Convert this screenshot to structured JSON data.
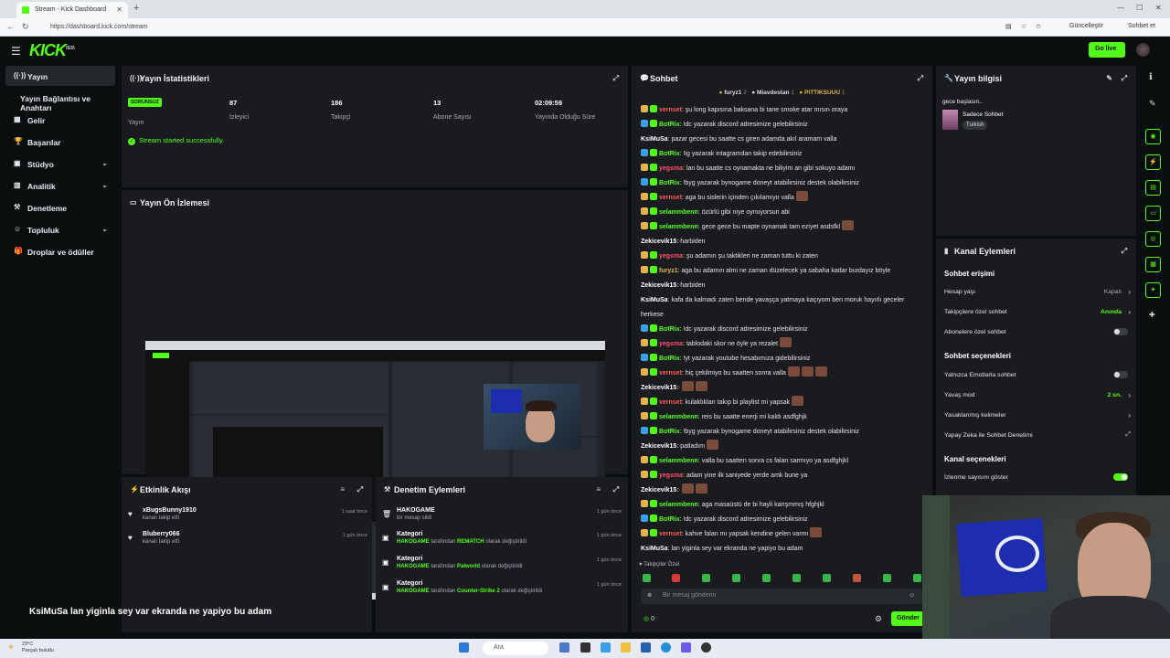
{
  "browser": {
    "tab_title": "Stream - Kick Dashboard",
    "url": "https://dashboard.kick.com/stream",
    "update_label": "Güncelleştir",
    "chat_label": "Sohbet et"
  },
  "header": {
    "logo": "KICK",
    "beta": "BETA",
    "go_live": "Go live"
  },
  "sidebar": {
    "items": [
      {
        "label": "Yayın"
      },
      {
        "label": "Yayın Bağlantısı ve Anahtarı"
      },
      {
        "label": "Gelir"
      },
      {
        "label": "Başarılar"
      },
      {
        "label": "Stüdyo"
      },
      {
        "label": "Analitik"
      },
      {
        "label": "Denetleme"
      },
      {
        "label": "Topluluk"
      },
      {
        "label": "Droplar ve ödüller"
      }
    ]
  },
  "stats": {
    "title": "Yayın İstatistikleri",
    "status_badge": "SORUNSUZ",
    "status_label": "Yayın",
    "viewers_value": "87",
    "viewers_label": "İzleyici",
    "followers_value": "186",
    "followers_label": "Takipçi",
    "subs_value": "13",
    "subs_label": "Abone Sayısı",
    "uptime_value": "02:09:59",
    "uptime_label": "Yayında Olduğu Süre",
    "started_message": "Stream started successfully."
  },
  "preview": {
    "title": "Yayın Ön İzlemesi"
  },
  "activity": {
    "title": "Etkinlik Akışı",
    "events": [
      {
        "name": "xBugsBunny1910",
        "desc": "kanalı takip etti",
        "time": "1 saat önce"
      },
      {
        "name": "Bluberry066",
        "desc": "kanalı takip etti",
        "time": "1 gün önce"
      }
    ]
  },
  "moderation": {
    "title": "Denetim Eylemleri",
    "items": [
      {
        "title": "HAKOGAME",
        "desc": "bir mesajı sildi",
        "time": "1 gün önce"
      },
      {
        "title": "Kategori",
        "actor": "HAKOGAME",
        "mid": "tarafından",
        "target": "REMATCH",
        "end": "olarak değiştirildi",
        "time": "1 gün önce"
      },
      {
        "title": "Kategori",
        "actor": "HAKOGAME",
        "mid": "tarafından",
        "target": "Palworld",
        "end": "olarak değiştirildi",
        "time": "1 gün önce"
      },
      {
        "title": "Kategori",
        "actor": "HAKOGAME",
        "mid": "tarafından",
        "target": "Counter-Strike 2",
        "end": "olarak değiştirildi",
        "time": "1 gün önce"
      }
    ]
  },
  "chat": {
    "title": "Sohbet",
    "pinned_1": "furyz1",
    "pinned_1_n": "2",
    "pinned_2": "Miavdestan",
    "pinned_2_n": "1",
    "pinned_3": "PITTIKSUUU",
    "pinned_3_n": "1",
    "messages": [
      {
        "user": "vernset",
        "color": "#ff5a5a",
        "text": "şu long kapısına baksana bi tane smoke atar mısın oraya"
      },
      {
        "user": "BotRix",
        "color": "#53fc18",
        "text": "!dc yazarak discord adresimize gelebilirsiniz"
      },
      {
        "user": "KsiMuSa",
        "color": "#ffffff",
        "text": "pazar gecesi bu saatte cs giren adamda akıl aramam valla"
      },
      {
        "user": "BotRix",
        "color": "#53fc18",
        "text": "!ig yazarak intagramdan takip edebilirsiniz"
      },
      {
        "user": "yegsma",
        "color": "#ff4d6d",
        "text": "lan bu saatte cs oynamakta ne biliyim an gibi sokuyo adamı"
      },
      {
        "user": "BotRix",
        "color": "#53fc18",
        "text": "!byg yazarak bynogame doneyt atabilirsiniz destek olabilirsiniz"
      },
      {
        "user": "vernset",
        "color": "#ff5a5a",
        "text": "aga bu sislerin içinden çıkılamıyo valla"
      },
      {
        "user": "selammbenn",
        "color": "#53fc18",
        "text": "özürlü gibi niye oynuyorsun abi"
      },
      {
        "user": "selammbenn",
        "color": "#53fc18",
        "text": "gece gece bu mapte oynamak tam eziyet asdsfkl"
      },
      {
        "user": "Zekicevik15",
        "color": "#ffffff",
        "text": "harbiden"
      },
      {
        "user": "yegsma",
        "color": "#ff4d6d",
        "text": "şu adamın şu taktikleri ne zaman tuttu ki zaten"
      },
      {
        "user": "furyz1",
        "color": "#e5b34a",
        "text": "aga bu adamın almi ne zaman düzelecek ya sabaha kadar burdayız böyle"
      },
      {
        "user": "Zekicevik15",
        "color": "#ffffff",
        "text": "harbiden"
      },
      {
        "user": "KsiMuSa",
        "color": "#ffffff",
        "text": "kafa da kalmadı zaten bende yavaşça yatmaya kaçıyom ben moruk hayırlı geceler"
      },
      {
        "user": "",
        "color": "#ffffff",
        "text": "herkese"
      },
      {
        "user": "BotRix",
        "color": "#53fc18",
        "text": "!dc yazarak discord adresimize gelebilirsiniz"
      },
      {
        "user": "yegsma",
        "color": "#ff4d6d",
        "text": "tablodaki skor ne öyle ya rezalet"
      },
      {
        "user": "BotRix",
        "color": "#53fc18",
        "text": "!yt yazarak youtube hesabımıza gidebilirsiniz"
      },
      {
        "user": "vernset",
        "color": "#ff5a5a",
        "text": "hiç çekilmiyo bu saatten sonra valla"
      },
      {
        "user": "Zekicevik15",
        "color": "#ffffff",
        "text": ""
      },
      {
        "user": "vernset",
        "color": "#ff5a5a",
        "text": "kulaklıkları takıp bi playlist mi yapsak"
      },
      {
        "user": "selammbenn",
        "color": "#53fc18",
        "text": "reis bu saatte enerji mi kaldı asdfghjk"
      },
      {
        "user": "BotRix",
        "color": "#53fc18",
        "text": "!byg yazarak bynogame doneyt atabilirsiniz destek olabilirsiniz"
      },
      {
        "user": "Zekicevik15",
        "color": "#ffffff",
        "text": "patladım"
      },
      {
        "user": "selammbenn",
        "color": "#53fc18",
        "text": "valla bu saatten sonra cs falan sarmıyo ya asdfghjkl"
      },
      {
        "user": "yegsma",
        "color": "#ff4d6d",
        "text": "adam yine ilk saniyede yerde amk bune ya"
      },
      {
        "user": "Zekicevik15",
        "color": "#ffffff",
        "text": ""
      },
      {
        "user": "selammbenn",
        "color": "#53fc18",
        "text": "aga masaüstü de bi hayli karışmmış hfghjkl"
      },
      {
        "user": "BotRix",
        "color": "#53fc18",
        "text": "!dc yazarak discord adresimize gelebilirsiniz"
      },
      {
        "user": "vernset",
        "color": "#ff5a5a",
        "text": "kahve falan mı yapsak kendine gelen varmı"
      },
      {
        "user": "KsiMuSa",
        "color": "#ffffff",
        "text": "lan yiginla sey var ekranda ne yapiyo bu adam"
      }
    ],
    "followers_only": "Takipçiler Özel",
    "input_placeholder": "Bir mesaj gönderin",
    "count": "0",
    "send": "Gönder"
  },
  "stream_info": {
    "title": "Yayın bilgisi",
    "stream_title": "gece başlasın..",
    "category": "Sadece Sohbet",
    "language": "Turkish"
  },
  "channel_actions": {
    "title": "Kanal Eylemleri",
    "chat_access": "Sohbet erişimi",
    "account_age": "Hesap yaşı",
    "account_age_value": "Kapalı",
    "followers_chat": "Takipçilere özel sohbet",
    "followers_chat_value": "Anında",
    "subs_chat": "Abonelere özel sohbet",
    "chat_options": "Sohbet seçenekleri",
    "emote_only": "Yalnızca Emotlarla sohbet",
    "slow_mode": "Yavaş mod",
    "slow_mode_value": "2 sn.",
    "banned_words": "Yasaklanmış kelimeler",
    "ai_moderation": "Yapay Zeka ile Sohbet Denetimi",
    "channel_options": "Kanal seçenekleri",
    "show_viewers": "İzlenme sayısını göster"
  },
  "overlay_text": "KsiMuSa  lan yiginla sey var ekranda ne yapiyo bu adam",
  "taskbar": {
    "temp": "23°C",
    "weather": "Parçalı bulutlu",
    "search": "Ara"
  },
  "colors": {
    "accent": "#53fc18",
    "panel": "#191b1f",
    "bg": "#0b0e0f"
  }
}
